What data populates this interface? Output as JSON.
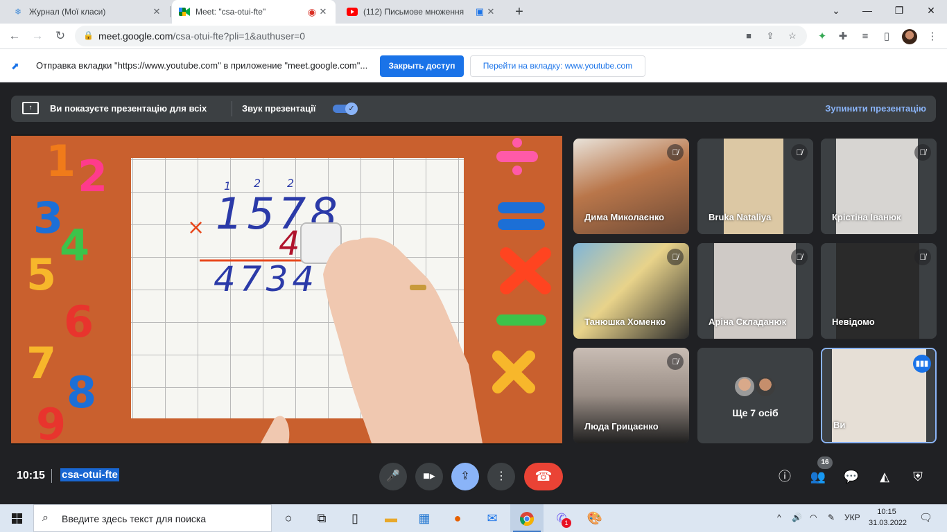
{
  "browser": {
    "tabs": [
      {
        "title": "Журнал (Мої класи)",
        "icon": "snowflake-icon"
      },
      {
        "title": "Meet: \"csa-otui-fte\"",
        "icon": "google-meet-icon",
        "active": true
      },
      {
        "title": "(112) Письмове множення",
        "icon": "youtube-icon"
      }
    ],
    "url_host": "meet.google.com",
    "url_path": "/csa-otui-fte?pli=1&authuser=0"
  },
  "infobar": {
    "message": "Отправка вкладки \"https://www.youtube.com\" в приложение \"meet.google.com\"...",
    "stop_sharing": "Закрыть доступ",
    "go_to_tab": "Перейти на вкладку: www.youtube.com"
  },
  "presenting_bar": {
    "message": "Ви показуєте презентацію для всіх",
    "sound_label": "Звук презентації",
    "sound_on": true,
    "stop_label": "Зупинити презентацію"
  },
  "presentation": {
    "multiplicand": "1578",
    "multiplier": "4",
    "product": "4734",
    "carries": [
      "1",
      "2",
      "2"
    ],
    "operator": "×"
  },
  "participants": [
    {
      "name": "Дима Миколаєнко",
      "muted": true
    },
    {
      "name": "Bruka Nataliya",
      "muted": true
    },
    {
      "name": "Крістіна Іванюк",
      "muted": true
    },
    {
      "name": "Танюшка Хоменко",
      "muted": true
    },
    {
      "name": "Аріна Складанюк",
      "muted": true
    },
    {
      "name": "Невідомо",
      "muted": true
    },
    {
      "name": "Люда Грицаєнко",
      "muted": true
    },
    {
      "name": "Ще 7 осіб",
      "muted": false
    },
    {
      "name": "Ви",
      "muted": false,
      "speaking": true
    }
  ],
  "meeting": {
    "time": "10:15",
    "code": "csa-otui-fte",
    "participant_count": "16"
  },
  "taskbar": {
    "search_placeholder": "Введите здесь текст для поиска",
    "viber_badge": "1",
    "language": "УКР",
    "time": "10:15",
    "date": "31.03.2022"
  },
  "colors": {
    "meet_bg": "#202124",
    "tile_bg": "#3c4043",
    "accent_blue": "#1a73e8",
    "leave_red": "#ea4335",
    "present_blue": "#8ab4f8"
  }
}
